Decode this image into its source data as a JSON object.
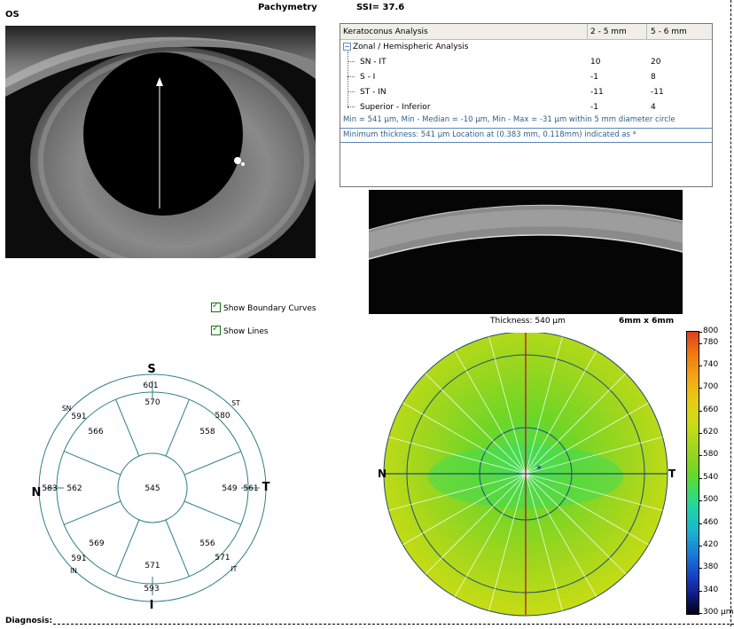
{
  "header": {
    "eye": "OS",
    "title": "Pachymetry",
    "ssi": "SSI= 37.6"
  },
  "keratoconus": {
    "title": "Keratoconus Analysis",
    "col1": "2 - 5 mm",
    "col2": "5 - 6 mm",
    "group": "Zonal / Hemispheric Analysis",
    "expander": "−",
    "rows": [
      {
        "label": "SN - IT",
        "v1": "10",
        "v2": "20"
      },
      {
        "label": "S - I",
        "v1": "-1",
        "v2": "8"
      },
      {
        "label": "ST - IN",
        "v1": "-11",
        "v2": "-11"
      },
      {
        "label": "Superior - Inferior",
        "v1": "-1",
        "v2": "4"
      }
    ],
    "note1": "Min = 541 µm, Min - Median = -10 µm, Min - Max = -31 µm within 5 mm diameter circle",
    "note2": "Minimum thickness: 541 µm     Location at (0.383 mm, 0.118mm) indicated as *"
  },
  "controls": {
    "show_boundary": "Show Boundary Curves",
    "show_lines": "Show Lines"
  },
  "oct": {
    "thickness_label": "Thickness: 540 µm",
    "size_label": "6mm x 6mm"
  },
  "sector_map": {
    "orientation": {
      "s": "S",
      "i": "I",
      "n": "N",
      "t": "T"
    },
    "corner_labels": {
      "sn": "SN",
      "st": "ST",
      "in": "IN",
      "it": "IT"
    },
    "center": "545",
    "inner": {
      "s": "570",
      "st": "558",
      "t": "549",
      "it": "556",
      "i": "571",
      "in": "569",
      "n": "562",
      "sn": "566"
    },
    "outer": {
      "s": "601",
      "st": "580",
      "t": "561",
      "it": "571",
      "i": "593",
      "in": "591",
      "n": "583",
      "sn": "591"
    }
  },
  "thickness_map": {
    "n": "N",
    "t": "T",
    "min_marker": "*"
  },
  "colorbar": {
    "labels": [
      "800",
      "780",
      "740",
      "700",
      "660",
      "620",
      "580",
      "540",
      "500",
      "460",
      "420",
      "380",
      "340",
      "300 µm"
    ],
    "colors": {
      "c800": "#e0401a",
      "c760": "#f07a10",
      "c720": "#f2ab12",
      "c680": "#e6cf12",
      "c640": "#c8dc14",
      "c600": "#9ed61e",
      "c560": "#6fd626",
      "c540": "#44dd55",
      "c500": "#22d6a0",
      "c460": "#1ab8d0",
      "c420": "#1a82d8",
      "c380": "#1646c8",
      "c340": "#101c8c",
      "c300": "#000010"
    }
  },
  "footer": {
    "diagnosis": "Diagnosis:"
  }
}
